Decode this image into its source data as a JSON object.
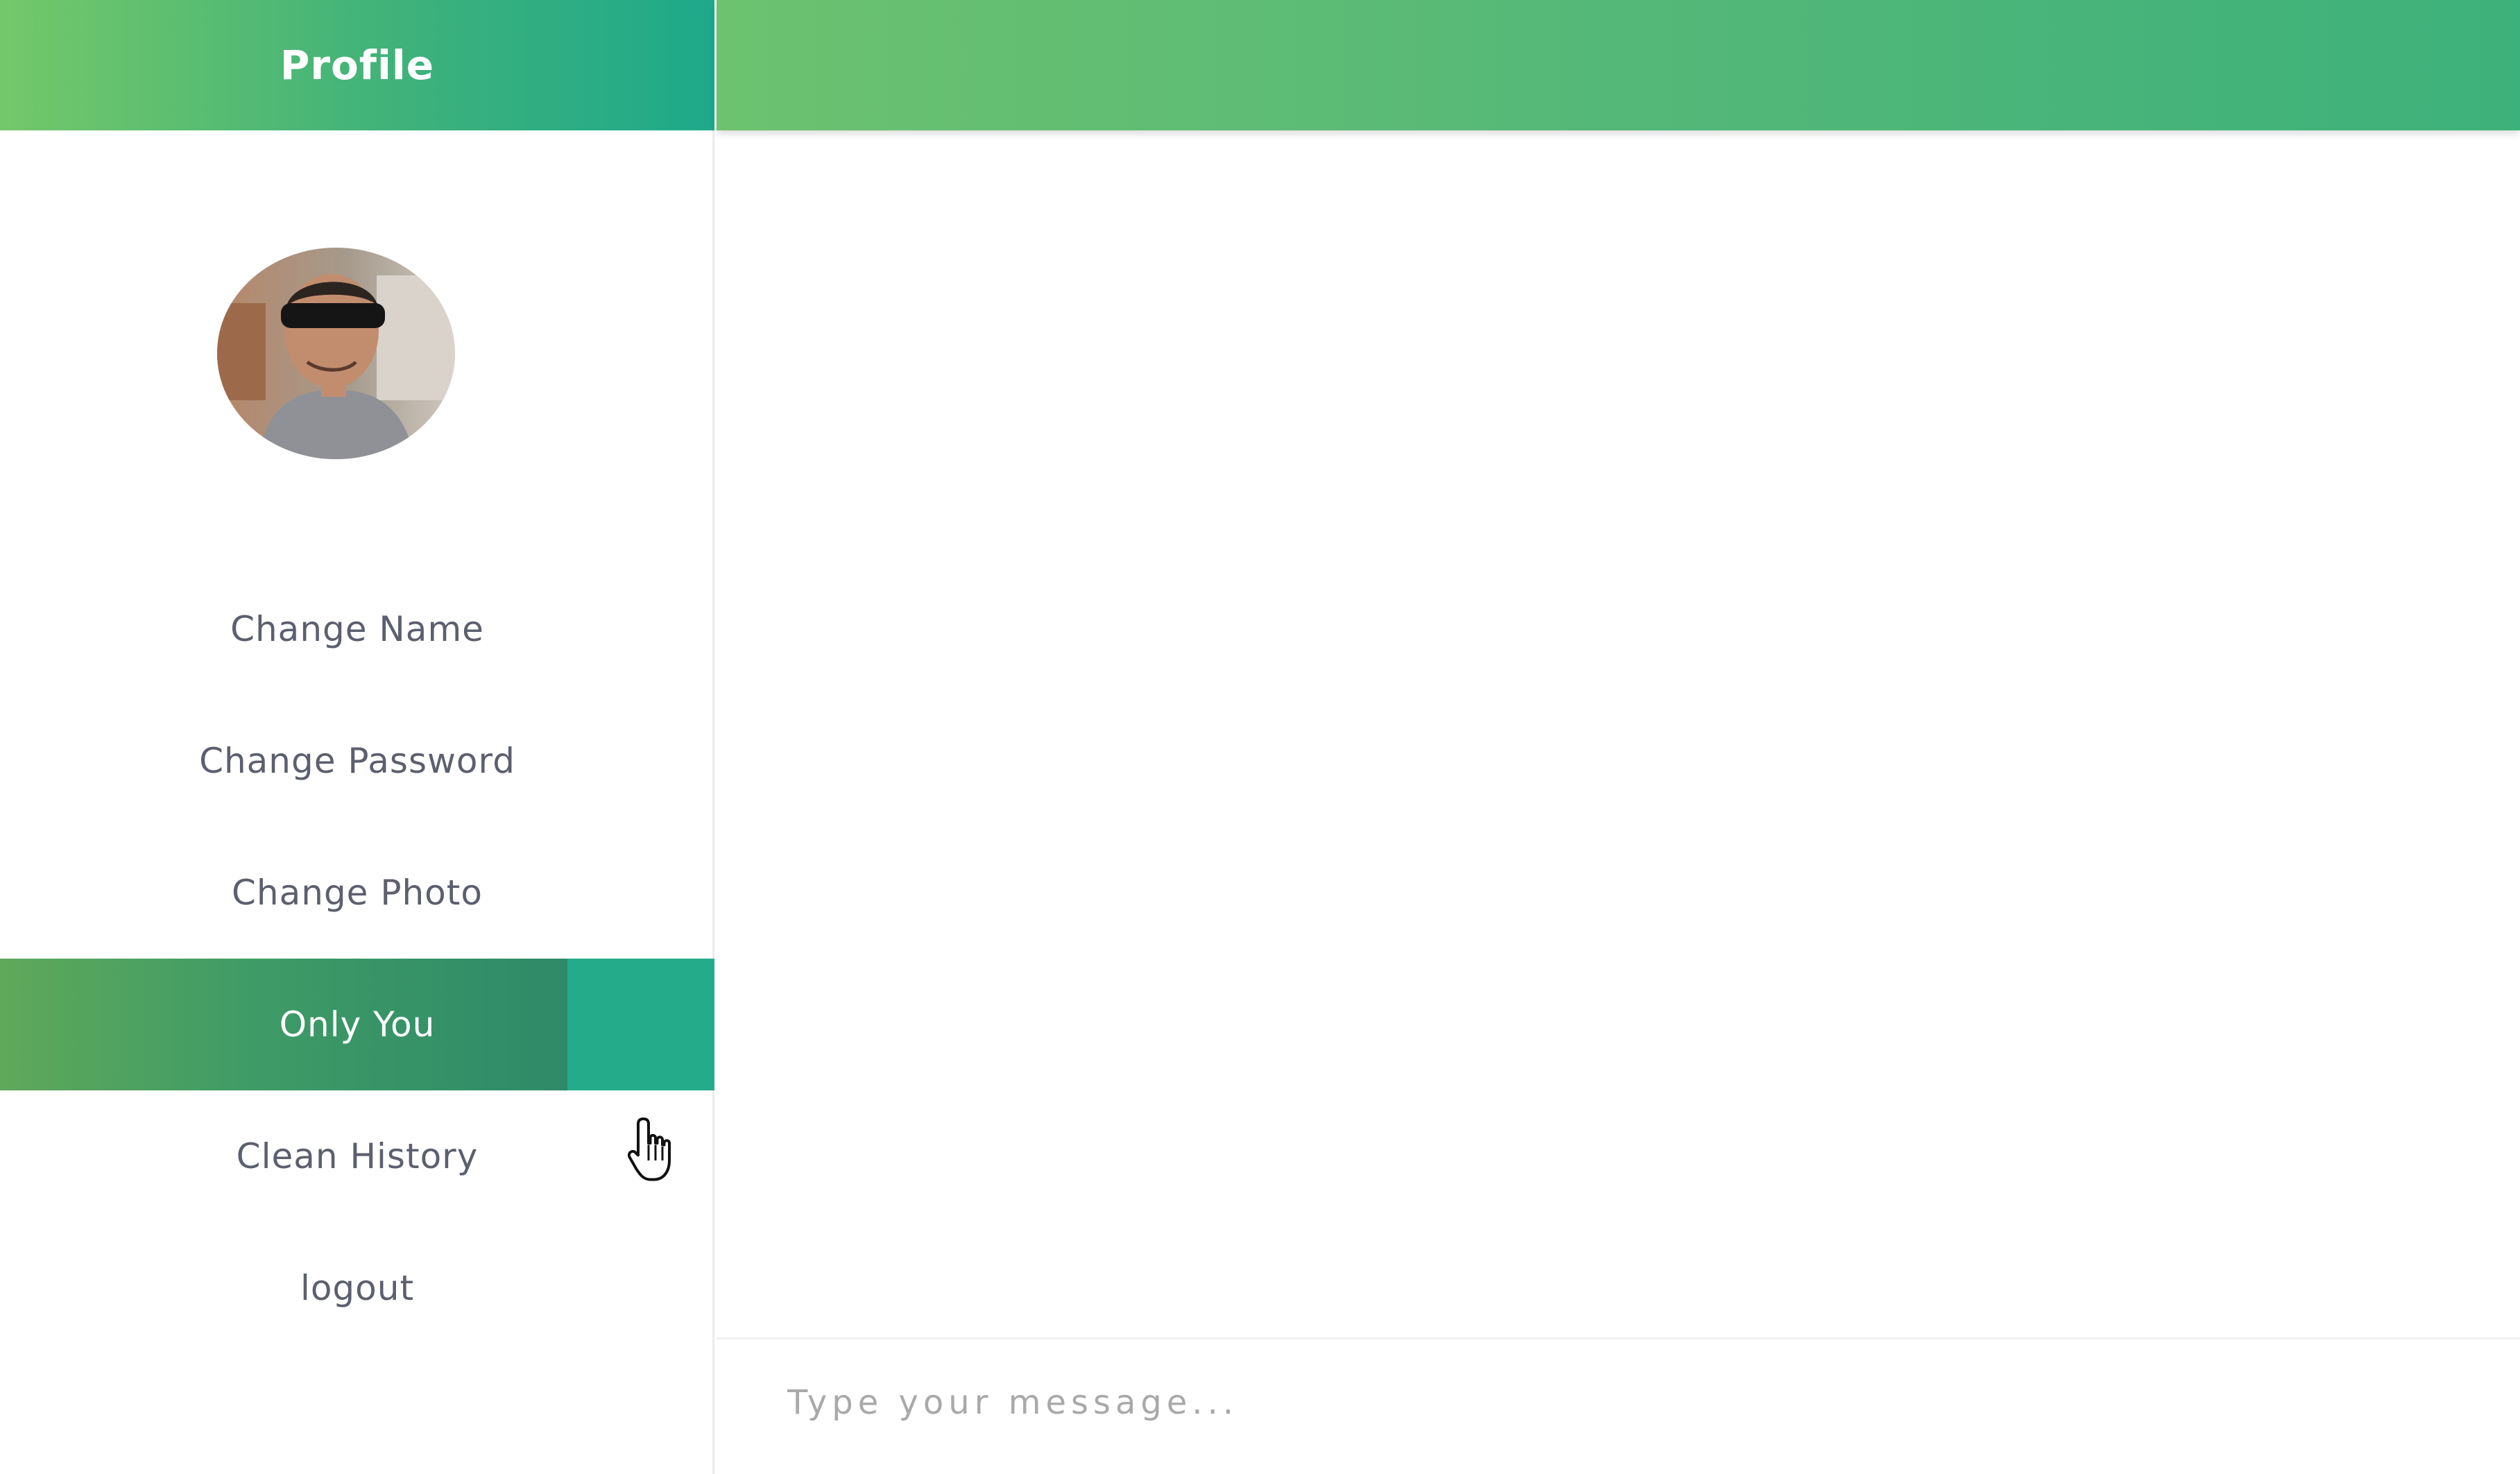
{
  "sidebar": {
    "title": "Profile",
    "menu": [
      {
        "label": "Change Name",
        "active": false
      },
      {
        "label": "Change Password",
        "active": false
      },
      {
        "label": "Change Photo",
        "active": false
      },
      {
        "label": "Only You",
        "active": true
      },
      {
        "label": "Clean History",
        "active": false
      },
      {
        "label": "logout",
        "active": false
      }
    ]
  },
  "composer": {
    "placeholder": "Type your message..."
  },
  "icons": {
    "avatar": "user-photo",
    "cursor": "hand-pointer-icon"
  },
  "colors": {
    "header_green_start": "#74c869",
    "header_green_end": "#1ea98a",
    "active_item": "#2e8a68",
    "active_accent": "#24ab8a",
    "menu_text": "#5b5f6e"
  }
}
